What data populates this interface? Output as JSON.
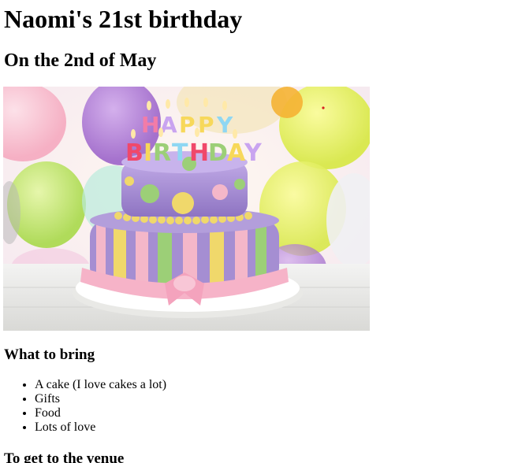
{
  "page": {
    "title": "Naomi's 21st birthday",
    "subtitle": "On the 2nd of May"
  },
  "image": {
    "alt": "Birthday cake with candles",
    "candles_text": "HAPPY BIRTHDAY"
  },
  "bring": {
    "heading": "What to bring",
    "items": [
      "A cake (I love cakes a lot)",
      "Gifts",
      "Food",
      "Lots of love"
    ]
  },
  "venue": {
    "heading": "To get to the venue"
  },
  "colors": {
    "cake_purple": "#a48fd0",
    "cake_pink": "#f4b3c6",
    "cake_yellow": "#f0d86b",
    "cake_green": "#9ccf77",
    "balloon_yellow": "#e9f05b",
    "table_white": "#eeeeee"
  }
}
